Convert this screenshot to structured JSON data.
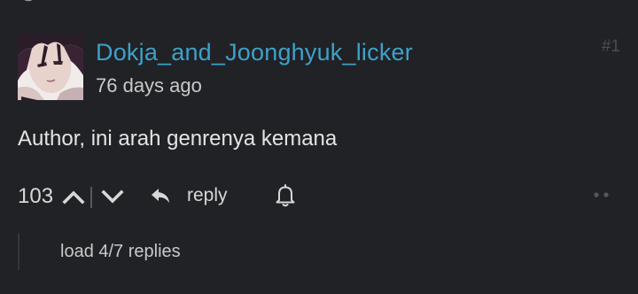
{
  "comment": {
    "username": "Dokja_and_Joonghyuk_licker",
    "time_ago": "76 days ago",
    "number": "#1",
    "text": "Author, ini arah genrenya kemana",
    "vote_count": "103",
    "reply_label": "reply",
    "load_replies_label": "load 4/7 replies"
  },
  "colors": {
    "background": "#202226",
    "username": "#3ea1c9",
    "text": "#e4e4e4",
    "muted": "#4a4d52"
  },
  "icons": {
    "upvote": "chevron-up-icon",
    "downvote": "chevron-down-icon",
    "reply": "reply-arrow-icon",
    "notify": "bell-icon",
    "more": "more-dots-icon"
  }
}
